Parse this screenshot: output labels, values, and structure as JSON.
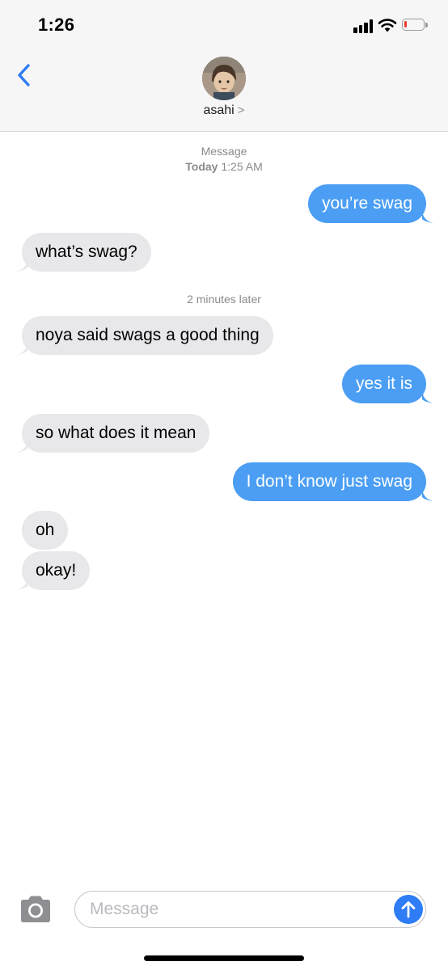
{
  "status_bar": {
    "time": "1:26",
    "battery_level": 0.1,
    "battery_color": "#ec3b2f",
    "signal_bars": 4
  },
  "header": {
    "back_icon": "chevron-left-icon",
    "contact_name": "asahi",
    "name_chevron": ">",
    "accent": "#2f7df6"
  },
  "thread": {
    "header_label": "Message",
    "header_day": "Today",
    "header_time": "1:25 AM",
    "gap_label": "2 minutes later",
    "messages": [
      {
        "from": "me",
        "text": "you’re swag"
      },
      {
        "from": "them",
        "text": "what’s swag?"
      },
      {
        "from": "them",
        "text": "noya said swags a good thing"
      },
      {
        "from": "me",
        "text": "yes it is"
      },
      {
        "from": "them",
        "text": "so what does it mean"
      },
      {
        "from": "me",
        "text": "I don’t know just swag"
      },
      {
        "from": "them",
        "text": "oh"
      },
      {
        "from": "them",
        "text": "okay!"
      }
    ],
    "sent_color": "#4b9ef3",
    "received_color": "#e8e8eb"
  },
  "compose": {
    "placeholder": "Message",
    "value": "",
    "camera_icon": "camera-icon",
    "send_icon": "arrow-up-icon"
  }
}
